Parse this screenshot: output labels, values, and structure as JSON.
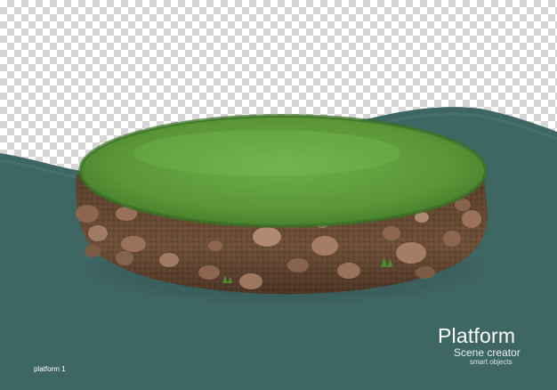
{
  "text": {
    "title": "Platform",
    "subtitle": "Scene creator",
    "small_line": "smart objects",
    "caption": "platform 1"
  },
  "colors": {
    "backdrop": "#3e6663",
    "grass": "#5c9a3a",
    "soil": "#6b4a34",
    "rock": "#9a6f57"
  },
  "icons": {
    "scene": "grass-platform-illustration"
  }
}
